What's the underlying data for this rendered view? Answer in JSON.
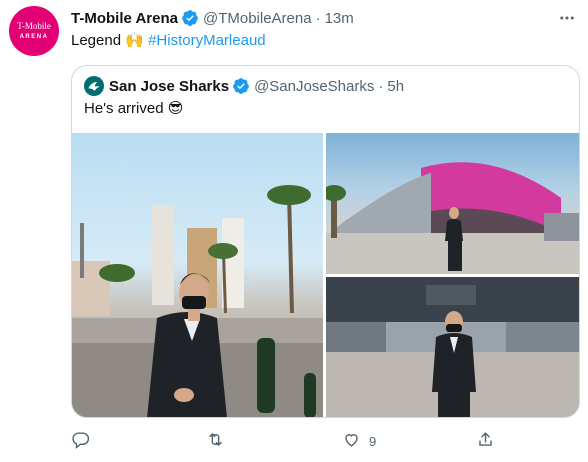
{
  "tweet": {
    "avatar": {
      "line1": "T-Mobile",
      "line2": "ARENA"
    },
    "author_name": "T-Mobile Arena",
    "author_handle": "@TMobileArena",
    "separator": "·",
    "time": "13m",
    "text_before": "Legend 🙌 ",
    "hashtag": "#HistoryMarleaud"
  },
  "quote": {
    "author_name": "San Jose Sharks",
    "author_handle": "@SanJoseSharks",
    "separator": "·",
    "time": "5h",
    "text": "He's arrived 😎",
    "photos": [
      "photo-street",
      "photo-arena-exterior",
      "photo-arena-entrance"
    ]
  },
  "actions": {
    "reply_count": "",
    "retweet_count": "",
    "like_count": "9",
    "share_count": ""
  },
  "colors": {
    "brand_magenta": "#e20074",
    "link_blue": "#1d9bf0",
    "verified_blue": "#1d9bf0",
    "muted_gray": "#536471",
    "border": "#cfd9de"
  },
  "icons": [
    "verified-badge-icon",
    "more-icon",
    "sharks-logo-icon",
    "reply-icon",
    "retweet-icon",
    "like-icon",
    "share-icon"
  ]
}
